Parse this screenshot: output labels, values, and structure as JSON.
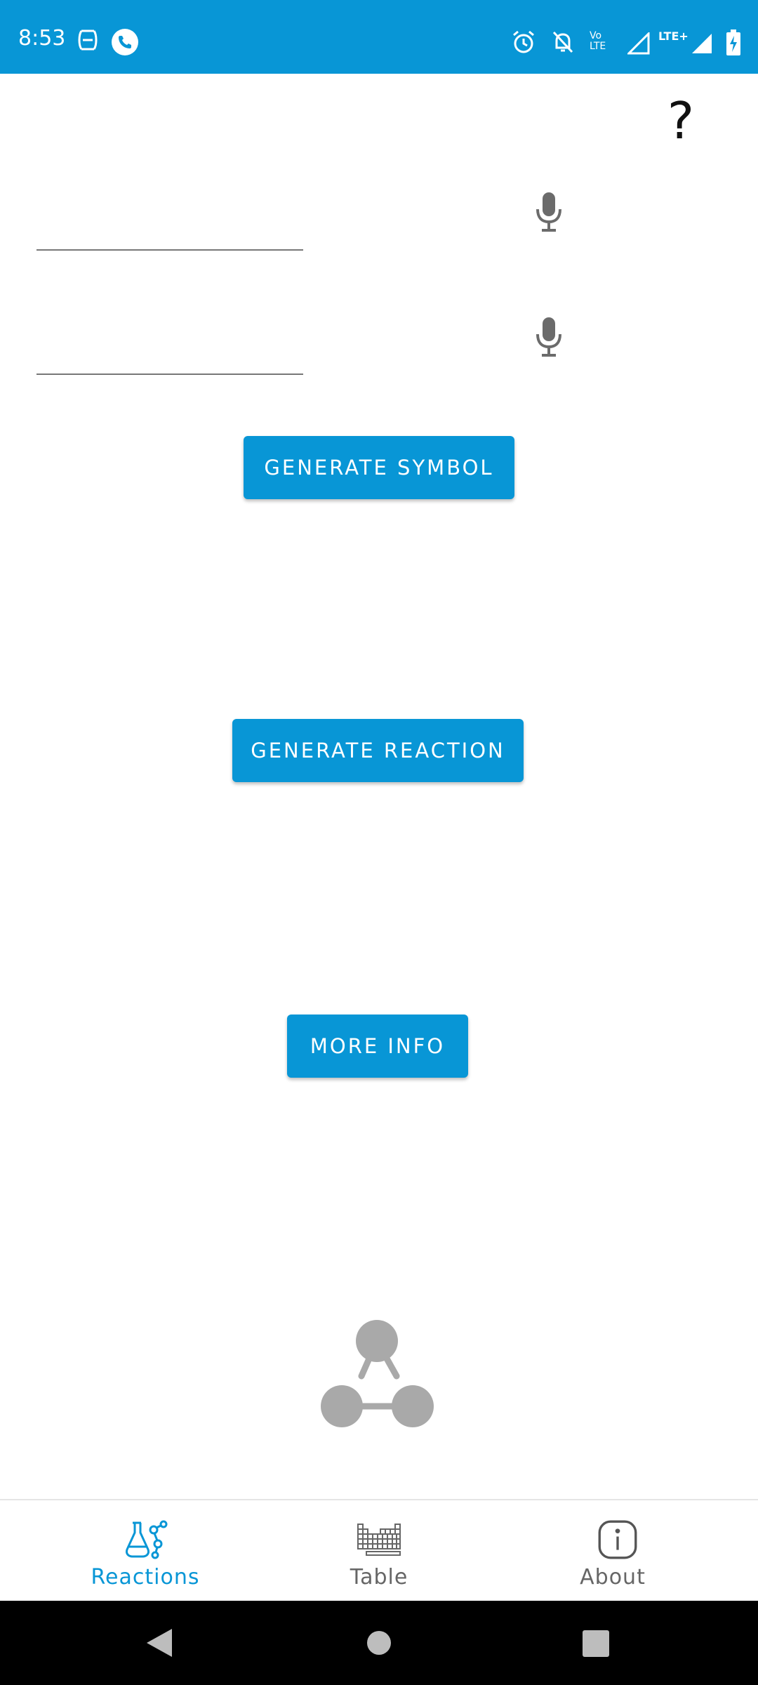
{
  "status_bar": {
    "time": "8:53",
    "background_color": "#0896d6",
    "left_icons": [
      "data-saver-icon",
      "phone-call-icon"
    ],
    "right_icons": [
      "alarm-icon",
      "notifications-off-icon",
      "volte-icon",
      "signal-icon",
      "lte-plus-icon",
      "signal-icon",
      "battery-charging-icon"
    ],
    "volte_label": "Vo LTE",
    "lte_label": "LTE+"
  },
  "help": {
    "label": "?"
  },
  "inputs": [
    {
      "value": "",
      "placeholder": ""
    },
    {
      "value": "",
      "placeholder": ""
    }
  ],
  "buttons": {
    "generate_symbol": "GENERATE SYMBOL",
    "generate_reaction": "GENERATE REACTION",
    "more_info": "MORE INFO"
  },
  "bottom_nav": {
    "items": [
      {
        "label": "Reactions",
        "icon": "reactions-flask-icon",
        "active": true
      },
      {
        "label": "Table",
        "icon": "periodic-table-icon",
        "active": false
      },
      {
        "label": "About",
        "icon": "info-icon",
        "active": false
      }
    ],
    "active_color": "#0896d6",
    "inactive_color": "#666666"
  },
  "system_nav": {
    "icons": [
      "back-icon",
      "home-icon",
      "recents-icon"
    ]
  }
}
